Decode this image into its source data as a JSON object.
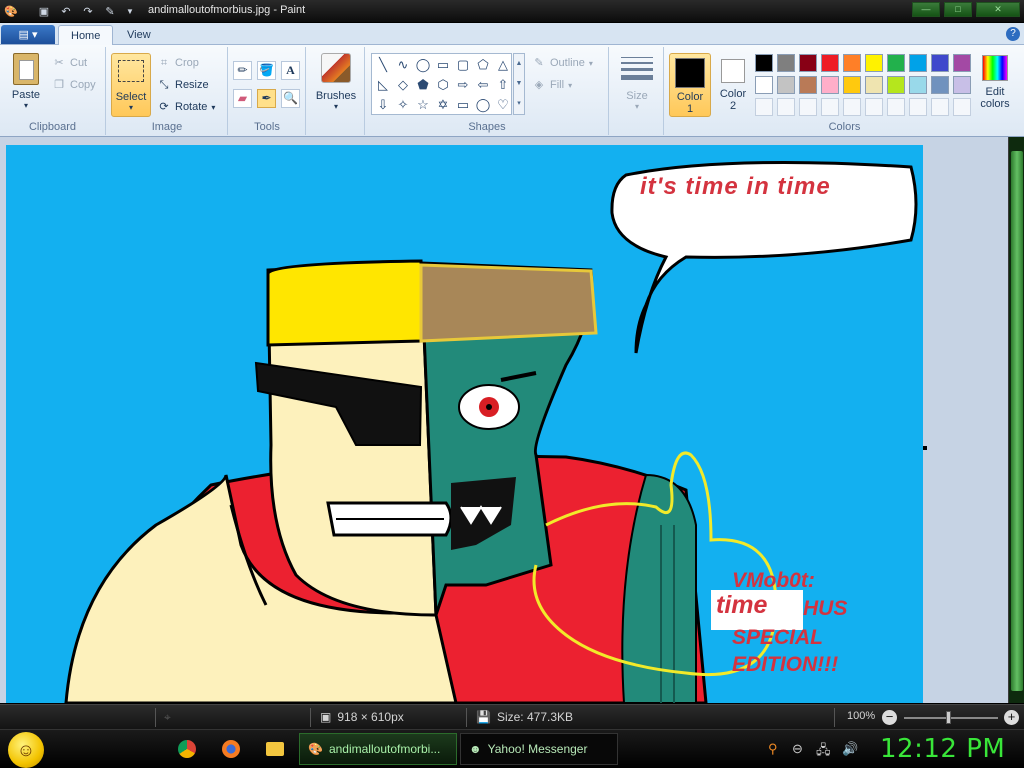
{
  "window": {
    "title": "andimalloutofmorbius.jpg - Paint"
  },
  "ribbon": {
    "tabs": [
      "Home",
      "View"
    ],
    "clipboard": {
      "paste": "Paste",
      "cut": "Cut",
      "copy": "Copy",
      "label": "Clipboard"
    },
    "image": {
      "select": "Select",
      "crop": "Crop",
      "resize": "Resize",
      "rotate": "Rotate",
      "label": "Image"
    },
    "tools": {
      "label": "Tools"
    },
    "brushes": {
      "label": "Brushes"
    },
    "shapes": {
      "outline": "Outline",
      "fill": "Fill",
      "label": "Shapes"
    },
    "size": {
      "label": "Size"
    },
    "colors": {
      "color1": "Color",
      "color1_num": "1",
      "color2": "Color",
      "color2_num": "2",
      "edit": "Edit",
      "edit2": "colors",
      "label": "Colors",
      "palette_row1": [
        "#000000",
        "#7f7f7f",
        "#880015",
        "#ed1c24",
        "#ff7f27",
        "#fff200",
        "#22b14c",
        "#00a2e8",
        "#3f48cc",
        "#a349a4"
      ],
      "palette_row2": [
        "#ffffff",
        "#c3c3c3",
        "#b97a57",
        "#ffaec9",
        "#ffc90e",
        "#efe4b0",
        "#b5e61d",
        "#99d9ea",
        "#7092be",
        "#c8bfe7"
      ]
    }
  },
  "painting": {
    "speech": "it's time in time",
    "caption_line1": "VMob0t:",
    "caption_overlay": "time",
    "caption_line2": "HUS",
    "caption_line3": "SPECIAL",
    "caption_line4": "EDITION!!!"
  },
  "status": {
    "dimensions": "918 × 610px",
    "size": "Size: 477.3KB",
    "zoom": "100%"
  },
  "taskbar": {
    "task_paint": "andimalloutofmorbi...",
    "task_messenger": "Yahoo! Messenger",
    "clock": "12:12 PM"
  }
}
